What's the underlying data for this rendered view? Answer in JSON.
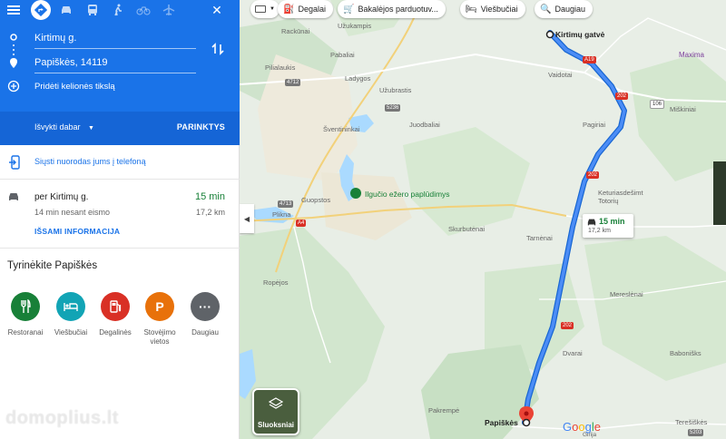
{
  "header": {
    "modes": [
      "menu-icon",
      "directions-icon",
      "car-icon",
      "transit-icon",
      "walk-icon",
      "bike-icon",
      "flight-icon"
    ],
    "close_label": "✕",
    "origin": "Kirtimų g.",
    "destination": "Papiškės, 14119",
    "add_destination": "Pridėti kelionės tikslą",
    "depart": "Išvykti dabar",
    "options": "PARINKTYS"
  },
  "send": {
    "label": "Siųsti nuorodas jums į telefoną"
  },
  "route": {
    "via": "per Kirtimų g.",
    "time": "15 min",
    "traffic": "14 min nesant eismo",
    "distance": "17,2 km",
    "details": "IŠSAMI INFORMACIJA"
  },
  "explore": {
    "title": "Tyrinėkite Papiškės",
    "items": [
      {
        "label": "Restoranai",
        "color": "#188038",
        "icon": "restaurant-icon"
      },
      {
        "label": "Viešbučiai",
        "color": "#12a4b5",
        "icon": "hotel-icon"
      },
      {
        "label": "Degalinės",
        "color": "#d93025",
        "icon": "gas-station-icon"
      },
      {
        "label": "Stovėjimo vietos",
        "color": "#e8710a",
        "icon": "parking-icon"
      },
      {
        "label": "Daugiau",
        "color": "#5f6368",
        "icon": "more-icon"
      }
    ]
  },
  "chips": {
    "fuel": "Degalai",
    "grocery": "Bakalėjos parduotuv...",
    "hotels": "Viešbučiai",
    "more": "Daugiau"
  },
  "map": {
    "origin_label": "Kirtimų gatvė",
    "destination_label": "Papiškės",
    "poi_beach": "Ilgučio ežero paplūdimys",
    "tooltip_time": "15 min",
    "tooltip_dist": "17,2 km",
    "layers": "Sluoksniai",
    "places": {
      "rackunai": "Rackūnai",
      "uzukampis": "Užukampis",
      "pilialaukis": "Pilialaukis",
      "pabaliai": "Pabaliai",
      "ladygos": "Ladygos",
      "uzubrastis": "Užubrastis",
      "vaidotai": "Vaidotai",
      "sventininkai": "Šventininkai",
      "juodbaliai": "Juodbaliai",
      "pagiriai": "Pagiriai",
      "miskiniai": "Miškiniai",
      "maxima": "Maxima",
      "guopstos": "Guopstos",
      "plikna": "Plikna",
      "keturiasdesimt": "Keturiasdešimt Totorių",
      "skurbutenai": "Skurbutėnai",
      "tamosai": "Tarnėnai",
      "ropeios": "Ropėjos",
      "mereslenai": "Mereslėnai",
      "dvarai": "Dvarai",
      "babonises": "Babonišks",
      "pakrempe": "Pakrempė",
      "tereskes": "Terešiškės",
      "girija": "Girija"
    },
    "shields": {
      "a19": "A19",
      "s202": "202",
      "s4712": "4712",
      "s5236": "5236",
      "s4713": "4713",
      "a4": "A4",
      "s106": "106",
      "s5203": "5203"
    },
    "watermark": "domoplius.lt"
  }
}
